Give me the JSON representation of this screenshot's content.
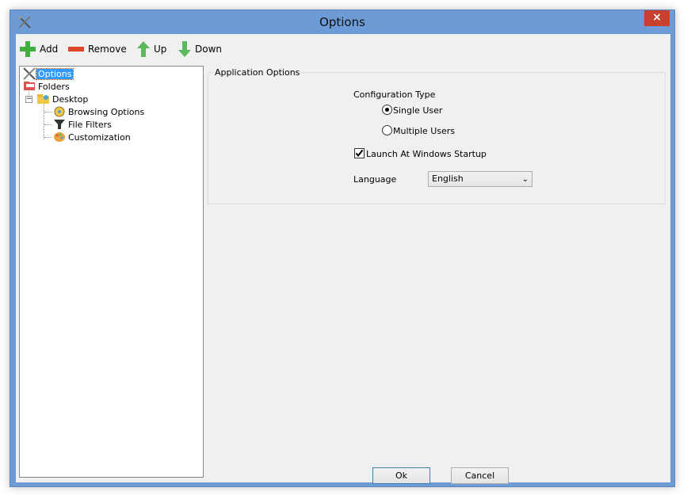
{
  "window": {
    "title": "Options",
    "close_label": "×"
  },
  "toolbar": {
    "add_label": "Add",
    "remove_label": "Remove",
    "up_label": "Up",
    "down_label": "Down"
  },
  "tree": {
    "items": [
      {
        "label": "Options",
        "icon": "tools-icon",
        "selected": true
      },
      {
        "label": "Folders",
        "icon": "folders-icon"
      },
      {
        "label": "Desktop",
        "icon": "desktop-folder-icon",
        "expander": "−"
      },
      {
        "label": "Browsing Options",
        "icon": "browsing-options-icon"
      },
      {
        "label": "File Filters",
        "icon": "funnel-icon"
      },
      {
        "label": "Customization",
        "icon": "palette-icon"
      }
    ]
  },
  "app_options": {
    "group_title": "Application Options",
    "config_type_label": "Configuration Type",
    "single_user_label": "Single User",
    "single_user_checked": true,
    "multiple_users_label": "Multiple Users",
    "multiple_users_checked": false,
    "launch_label": "Launch At Windows Startup",
    "launch_checked": true,
    "language_label": "Language",
    "language_value": "English"
  },
  "buttons": {
    "ok_label": "Ok",
    "cancel_label": "Cancel"
  },
  "colors": {
    "frame": "#6d9bd6",
    "close": "#c8402e",
    "selection": "#3399ff",
    "add": "#3fae3f",
    "remove": "#e0442c"
  }
}
